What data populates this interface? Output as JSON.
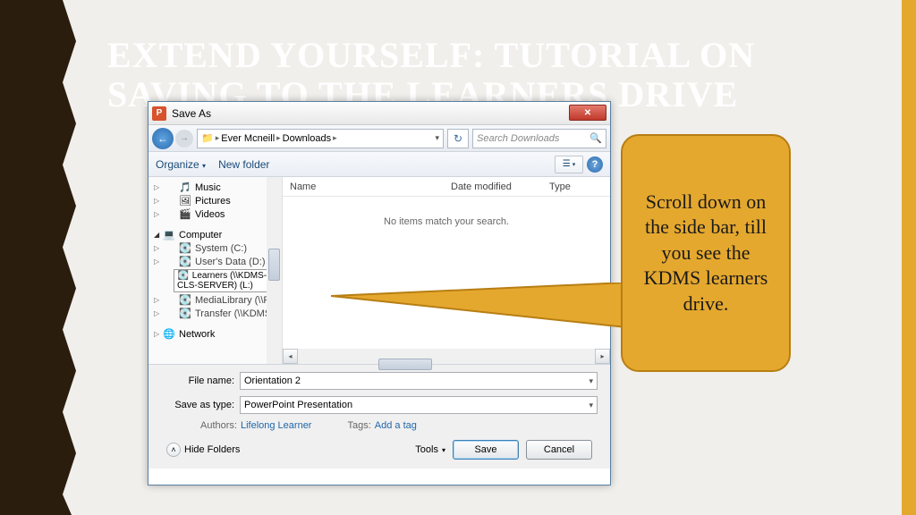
{
  "slide": {
    "title": "EXTEND YOURSELF: TUTORIAL ON SAVING TO THE LEARNERS DRIVE"
  },
  "dialog": {
    "title": "Save As",
    "close_label": "✕",
    "nav": {
      "breadcrumb": [
        "Ever Mcneill",
        "Downloads"
      ],
      "search_placeholder": "Search Downloads"
    },
    "toolbar": {
      "organize": "Organize",
      "newfolder": "New folder"
    },
    "tree": {
      "music": "Music",
      "pictures": "Pictures",
      "videos": "Videos",
      "computer": "Computer",
      "system_c": "System (C:)",
      "user_data_d": "User's Data (D:)",
      "learners": "Learners (\\\\KDMS-CLS-SERVER) (L:)",
      "medialibrary": "MediaLibrary (\\\\F",
      "transfer": "Transfer (\\\\KDMS",
      "network": "Network"
    },
    "list": {
      "col_name": "Name",
      "col_date": "Date modified",
      "col_type": "Type",
      "empty": "No items match your search."
    },
    "fields": {
      "filename_label": "File name:",
      "filename_value": "Orientation 2",
      "saveastype_label": "Save as type:",
      "saveastype_value": "PowerPoint Presentation",
      "authors_label": "Authors:",
      "authors_value": "Lifelong Learner",
      "tags_label": "Tags:",
      "tags_value": "Add a tag"
    },
    "buttons": {
      "hide": "Hide Folders",
      "tools": "Tools",
      "save": "Save",
      "cancel": "Cancel"
    }
  },
  "callout": {
    "text": "Scroll down on the side bar, till you see the KDMS learners drive."
  }
}
